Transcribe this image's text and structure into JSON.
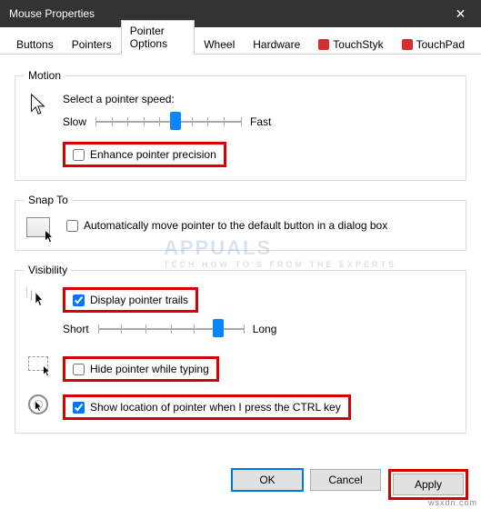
{
  "window": {
    "title": "Mouse Properties"
  },
  "tabs": [
    {
      "label": "Buttons"
    },
    {
      "label": "Pointers"
    },
    {
      "label": "Pointer Options"
    },
    {
      "label": "Wheel"
    },
    {
      "label": "Hardware"
    },
    {
      "label": "TouchStyk"
    },
    {
      "label": "TouchPad"
    }
  ],
  "motion": {
    "legend": "Motion",
    "caption": "Select a pointer speed:",
    "slow": "Slow",
    "fast": "Fast",
    "enhance_label": "Enhance pointer precision",
    "enhance_checked": false
  },
  "snap": {
    "legend": "Snap To",
    "auto_label": "Automatically move pointer to the default button in a dialog box",
    "auto_checked": false
  },
  "visibility": {
    "legend": "Visibility",
    "trails_label": "Display pointer trails",
    "trails_checked": true,
    "short": "Short",
    "long": "Long",
    "hide_label": "Hide pointer while typing",
    "hide_checked": false,
    "ctrl_label": "Show location of pointer when I press the CTRL key",
    "ctrl_checked": true
  },
  "buttons": {
    "ok": "OK",
    "cancel": "Cancel",
    "apply": "Apply"
  },
  "watermark": {
    "brand": "APPUALS",
    "tag": "TECH HOW TO'S FROM THE EXPERTS"
  },
  "credit": "wsxdn.com"
}
